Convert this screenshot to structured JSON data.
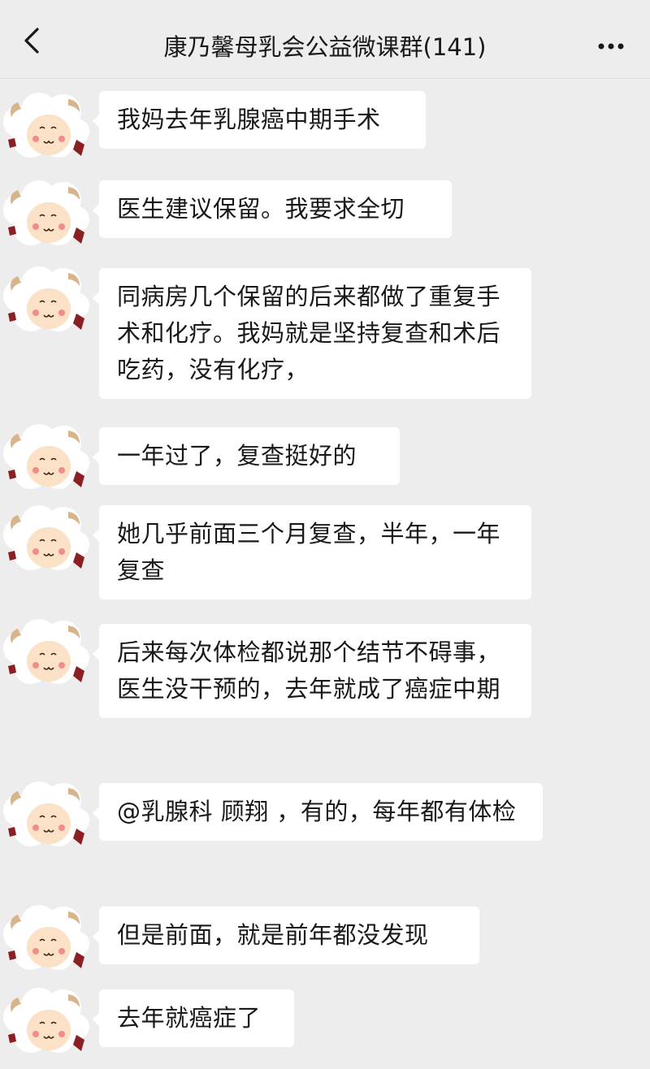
{
  "header": {
    "title": "康乃馨母乳会公益微课群(141)",
    "back_icon": "chevron-left-icon",
    "more_icon": "more-dots-icon"
  },
  "messages": [
    {
      "text": "我妈去年乳腺癌中期手术"
    },
    {
      "text": "医生建议保留。我要求全切"
    },
    {
      "text": "同病房几个保留的后来都做了重复手术和化疗。我妈就是坚持复查和术后吃药，没有化疗，"
    },
    {
      "text": "一年过了，复查挺好的"
    },
    {
      "text": "她几乎前面三个月复查，半年，一年复查"
    },
    {
      "text": "后来每次体检都说那个结节不碍事，医生没干预的，去年就成了癌症中期"
    },
    {
      "text": "@乳腺科 顾翔 ，有的，每年都有体检"
    },
    {
      "text": "但是前面，就是前年都没发现"
    },
    {
      "text": "去年就癌症了"
    }
  ],
  "colors": {
    "background": "#ededed",
    "bubble": "#ffffff",
    "text": "#191919"
  }
}
